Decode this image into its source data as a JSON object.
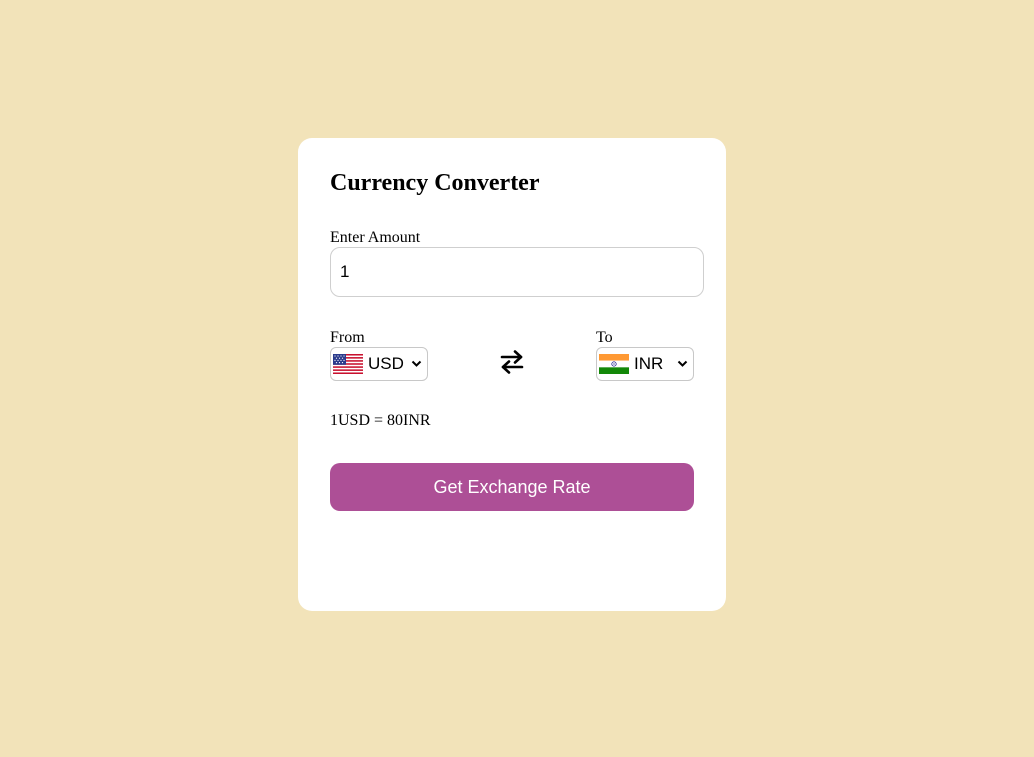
{
  "converter": {
    "title": "Currency Converter",
    "amount_label": "Enter Amount",
    "amount_value": "1",
    "from_label": "From",
    "from_currency": "USD",
    "from_flag_icon": "us-flag-icon",
    "to_label": "To",
    "to_currency": "INR",
    "to_flag_icon": "india-flag-icon",
    "swap_icon": "swap-arrows-icon",
    "rate_message": "1USD = 80INR",
    "button_label": "Get Exchange Rate"
  },
  "colors": {
    "page_background": "#f2e3b9",
    "card_background": "#ffffff",
    "button_background": "#ad4f96",
    "button_text": "#ffffff"
  }
}
